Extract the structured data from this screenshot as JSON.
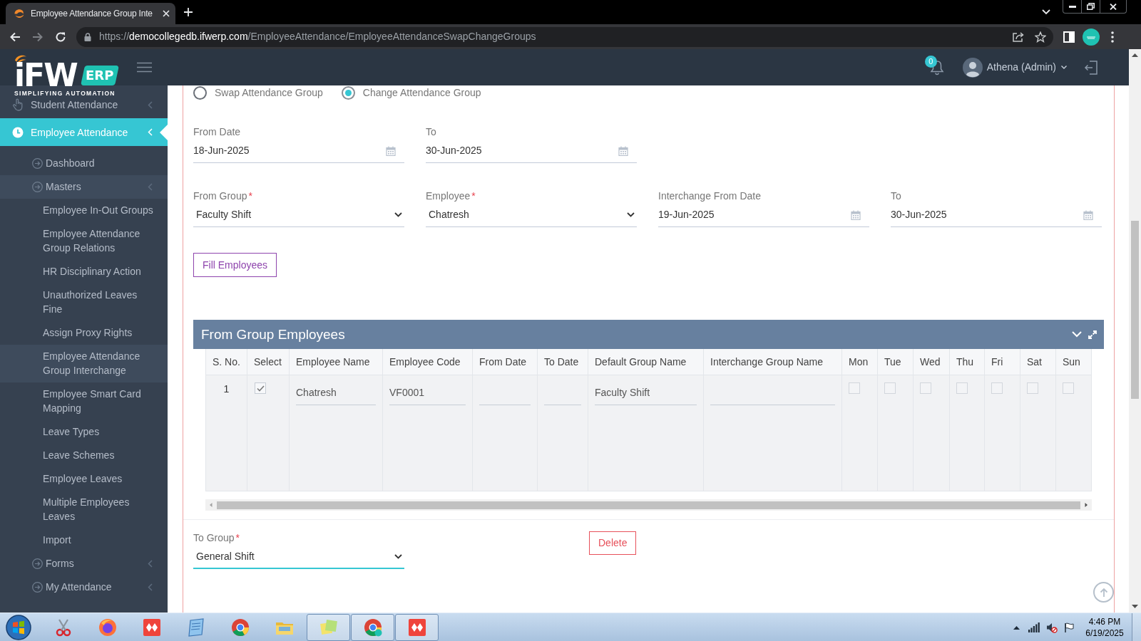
{
  "browser": {
    "tab_title": "Employee Attendance Group Inte",
    "url": {
      "scheme": "https://",
      "host": "democollegedb.ifwerp.com",
      "path": "/EmployeeAttendance/EmployeeAttendanceSwapChangeGroups"
    }
  },
  "header": {
    "logo": {
      "brand": "iFW",
      "product": "ERP",
      "tagline": "SIMPLIFYING AUTOMATION"
    },
    "notification_count": "0",
    "user_name": "Athena (Admin)"
  },
  "sidebar": {
    "items": [
      {
        "label": "Student Attendance",
        "selected": false,
        "expandable": true
      },
      {
        "label": "Employee Attendance",
        "selected": true,
        "expandable": true,
        "children": [
          {
            "label": "Dashboard",
            "selected": false,
            "expandable": false
          },
          {
            "label": "Masters",
            "selected": true,
            "expandable": true,
            "children": [
              {
                "label": "Employee In-Out Groups",
                "selected": false
              },
              {
                "label": "Employee Attendance Group Relations",
                "selected": false
              },
              {
                "label": "HR Disciplinary Action",
                "selected": false
              },
              {
                "label": "Unauthorized Leaves Fine",
                "selected": false
              },
              {
                "label": "Assign Proxy Rights",
                "selected": false
              },
              {
                "label": "Employee Attendance Group Interchange",
                "selected": true
              },
              {
                "label": "Employee Smart Card Mapping",
                "selected": false
              },
              {
                "label": "Leave Types",
                "selected": false
              },
              {
                "label": "Leave Schemes",
                "selected": false
              },
              {
                "label": "Employee Leaves",
                "selected": false
              },
              {
                "label": "Multiple Employees Leaves",
                "selected": false
              },
              {
                "label": "Import",
                "selected": false
              }
            ]
          },
          {
            "label": "Forms",
            "selected": false,
            "expandable": true
          },
          {
            "label": "My Attendance",
            "selected": false,
            "expandable": true
          }
        ]
      }
    ]
  },
  "form": {
    "modes": [
      {
        "label": "Swap Attendance Group",
        "selected": false
      },
      {
        "label": "Change Attendance Group",
        "selected": true
      }
    ],
    "field_rows": [
      [
        {
          "label": "From Date",
          "kind": "date",
          "value": "18-Jun-2025"
        },
        {
          "label": "To",
          "kind": "date",
          "value": "30-Jun-2025"
        }
      ],
      [
        {
          "label": "From Group",
          "required_mark": "*",
          "kind": "select",
          "value": "Faculty Shift"
        },
        {
          "label": "Employee",
          "required_mark": "*",
          "kind": "select",
          "value": "Chatresh"
        },
        {
          "label": "Interchange From Date",
          "kind": "date",
          "value": "19-Jun-2025"
        },
        {
          "label": "To",
          "kind": "date",
          "value": "30-Jun-2025"
        }
      ]
    ],
    "fill_button": "Fill Employees"
  },
  "employees_panel": {
    "title": "From Group Employees",
    "columns": [
      "S. No.",
      "Select",
      "Employee Name",
      "Employee Code",
      "From Date",
      "To Date",
      "Default Group Name",
      "Interchange Group Name",
      "Mon",
      "Tue",
      "Wed",
      "Thu",
      "Fri",
      "Sat",
      "Sun"
    ],
    "rows": [
      {
        "s_no": "1",
        "checked": true,
        "fields": [
          {
            "kind": "text",
            "value": "Chatresh"
          },
          {
            "kind": "text",
            "value": "VF0001"
          },
          {
            "kind": "text"
          },
          {
            "kind": "text"
          },
          {
            "kind": "text",
            "value": "Faculty Shift"
          },
          {
            "kind": "text"
          }
        ],
        "days": [
          {
            "checked": false
          },
          {
            "checked": false
          },
          {
            "checked": false
          },
          {
            "checked": false
          },
          {
            "checked": false
          },
          {
            "checked": false
          },
          {
            "checked": false
          }
        ]
      }
    ]
  },
  "to_group": {
    "label": "To Group",
    "required_mark": "*",
    "kind": "select",
    "value": "General Shift",
    "focused": true
  },
  "delete_button": "Delete",
  "taskbar": {
    "apps": [
      {
        "running": false
      },
      {
        "running": false
      },
      {
        "running": false
      },
      {
        "running": false
      },
      {
        "running": false
      },
      {
        "running": false
      },
      {
        "running": true
      },
      {
        "running": true
      },
      {
        "running": true
      }
    ],
    "time": "4:46 PM",
    "date": "6/19/2025"
  }
}
